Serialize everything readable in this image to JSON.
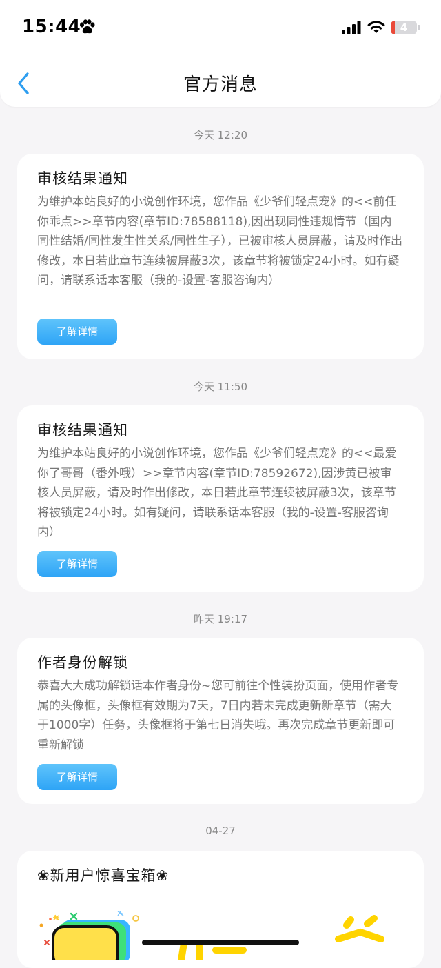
{
  "status_bar": {
    "time": "15:44",
    "battery": "4"
  },
  "header": {
    "title": "官方消息"
  },
  "messages": [
    {
      "timestamp": "今天 12:20",
      "title": "审核结果通知",
      "body": "为维护本站良好的小说创作环境，您作品《少爷们轻点宠》的<<前任你乖点>>章节内容(章节ID:78588118),因出现同性违规情节（国内同性结婚/同性发生性关系/同性生子），已被审核人员屏蔽，请及时作出修改，本日若此章节连续被屏蔽3次，该章节将被锁定24小时。如有疑问，请联系话本客服（我的-设置-客服咨询内）",
      "button": "了解详情"
    },
    {
      "timestamp": "今天 11:50",
      "title": "审核结果通知",
      "body": "为维护本站良好的小说创作环境，您作品《少爷们轻点宠》的<<最爱你了哥哥（番外哦）>>章节内容(章节ID:78592672),因涉黄已被审核人员屏蔽，请及时作出修改，本日若此章节连续被屏蔽3次，该章节将被锁定24小时。如有疑问，请联系话本客服（我的-设置-客服咨询内）",
      "button": "了解详情"
    },
    {
      "timestamp": "昨天 19:17",
      "title": "作者身份解锁",
      "body": "恭喜大大成功解锁话本作者身份~您可前往个性装扮页面，使用作者专属的头像框，头像框有效期为7天，7日内若未完成更新新章节（需大于1000字）任务，头像框将于第七日消失哦。再次完成章节更新即可重新解锁",
      "button": "了解详情"
    },
    {
      "timestamp": "04-27",
      "title": "❀新用户惊喜宝箱❀"
    }
  ],
  "colors": {
    "accent": "#2ea4f6",
    "background": "#f6f5f7",
    "card": "#ffffff"
  }
}
